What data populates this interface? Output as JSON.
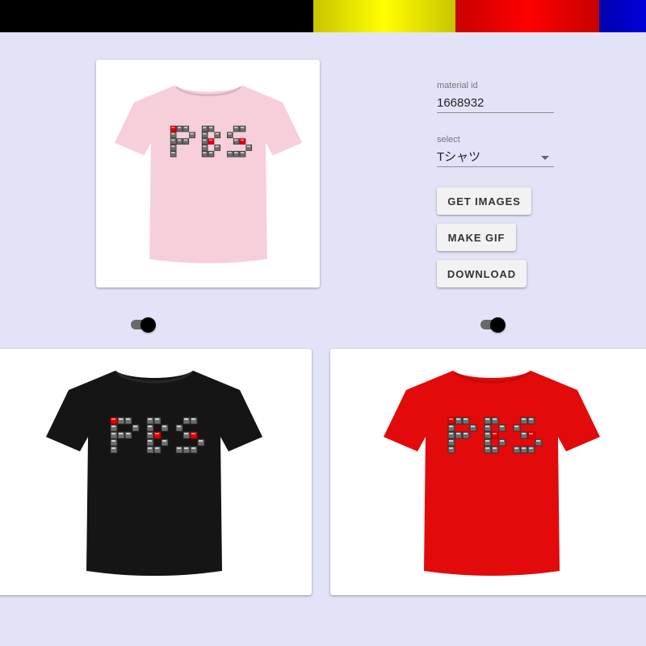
{
  "top_bar": {
    "colors": [
      "#000000",
      "#ffff00",
      "#ff0000",
      "#0000d8"
    ]
  },
  "preview": {
    "shirt_color": "#f6cfdb",
    "design_text": "PBS"
  },
  "form": {
    "material_id": {
      "label": "material id",
      "value": "1668932"
    },
    "select": {
      "label": "select",
      "value": "Tシャツ",
      "caret_icon": "arrow-drop-down-icon"
    }
  },
  "buttons": {
    "get_images": "GET IMAGES",
    "make_gif": "MAKE GIF",
    "download": "DOWNLOAD"
  },
  "toggles": [
    {
      "on": true
    },
    {
      "on": true
    }
  ],
  "variants": [
    {
      "shirt_color": "#151515",
      "design_text": "PBS"
    },
    {
      "shirt_color": "#e20a0a",
      "design_text": "PBS"
    }
  ]
}
